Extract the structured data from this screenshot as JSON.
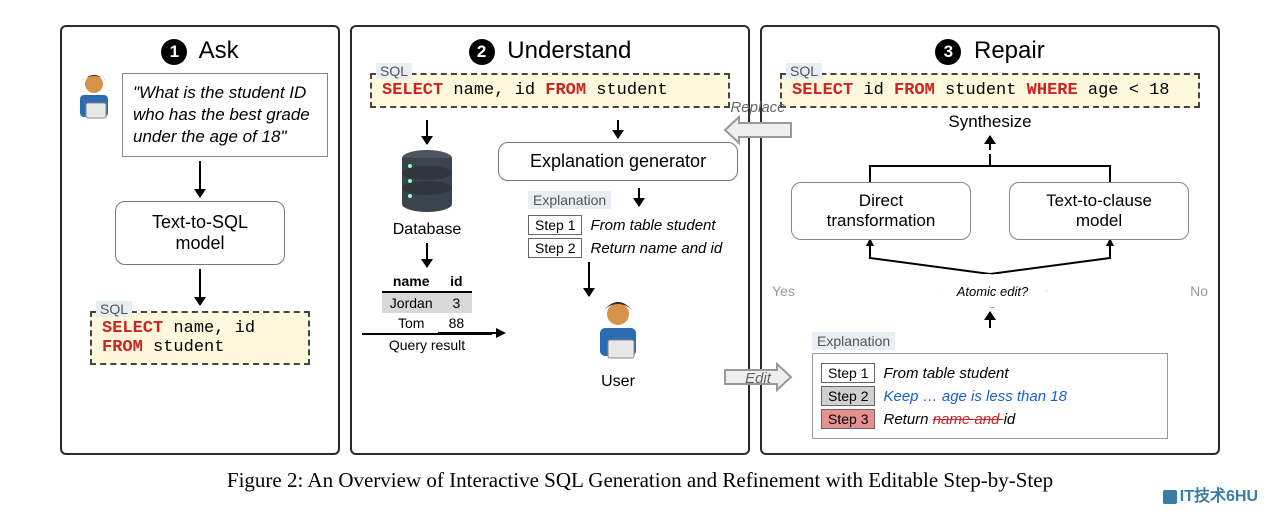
{
  "panels": {
    "ask": {
      "num": "1",
      "title": "Ask",
      "query": "\"What is the student ID who has the best grade under the age of 18\"",
      "model": "Text-to-SQL model",
      "sql_label": "SQL",
      "sql_tokens": [
        "SELECT",
        " name, id ",
        "FROM",
        " student"
      ]
    },
    "understand": {
      "num": "2",
      "title": "Understand",
      "sql_label": "SQL",
      "sql_tokens": [
        "SELECT",
        " name, id ",
        "FROM",
        " student"
      ],
      "gen": "Explanation generator",
      "db_label": "Database",
      "expl_label": "Explanation",
      "steps": [
        {
          "num": "Step 1",
          "text": "From table student"
        },
        {
          "num": "Step 2",
          "text": "Return name and id"
        }
      ],
      "table": {
        "headers": [
          "name",
          "id"
        ],
        "rows": [
          [
            "Jordan",
            "3"
          ],
          [
            "Tom",
            "88"
          ]
        ]
      },
      "result_label": "Query result",
      "user_label": "User"
    },
    "repair": {
      "num": "3",
      "title": "Repair",
      "sql_label": "SQL",
      "sql_tokens": [
        "SELECT",
        " id ",
        "FROM",
        " student ",
        "WHERE",
        " age < 18"
      ],
      "synth": "Synthesize",
      "direct": "Direct transformation",
      "t2c": "Text-to-clause model",
      "yes": "Yes",
      "no": "No",
      "atomic": "Atomic edit?",
      "expl_label": "Explanation",
      "steps": [
        {
          "num": "Step 1",
          "text": "From table student",
          "cls": ""
        },
        {
          "num": "Step 2",
          "text": "Keep … age is less than 18",
          "cls": "blue"
        },
        {
          "num": "Step 3",
          "pre": "Return ",
          "strike": "name and ",
          "post": "id",
          "cls": "strike-row"
        }
      ]
    }
  },
  "arrows": {
    "replace": "Replace",
    "edit": "Edit"
  },
  "caption": "Figure 2: An Overview of Interactive SQL Generation and Refinement with Editable Step-by-Step",
  "watermark": "IT技术6HU"
}
